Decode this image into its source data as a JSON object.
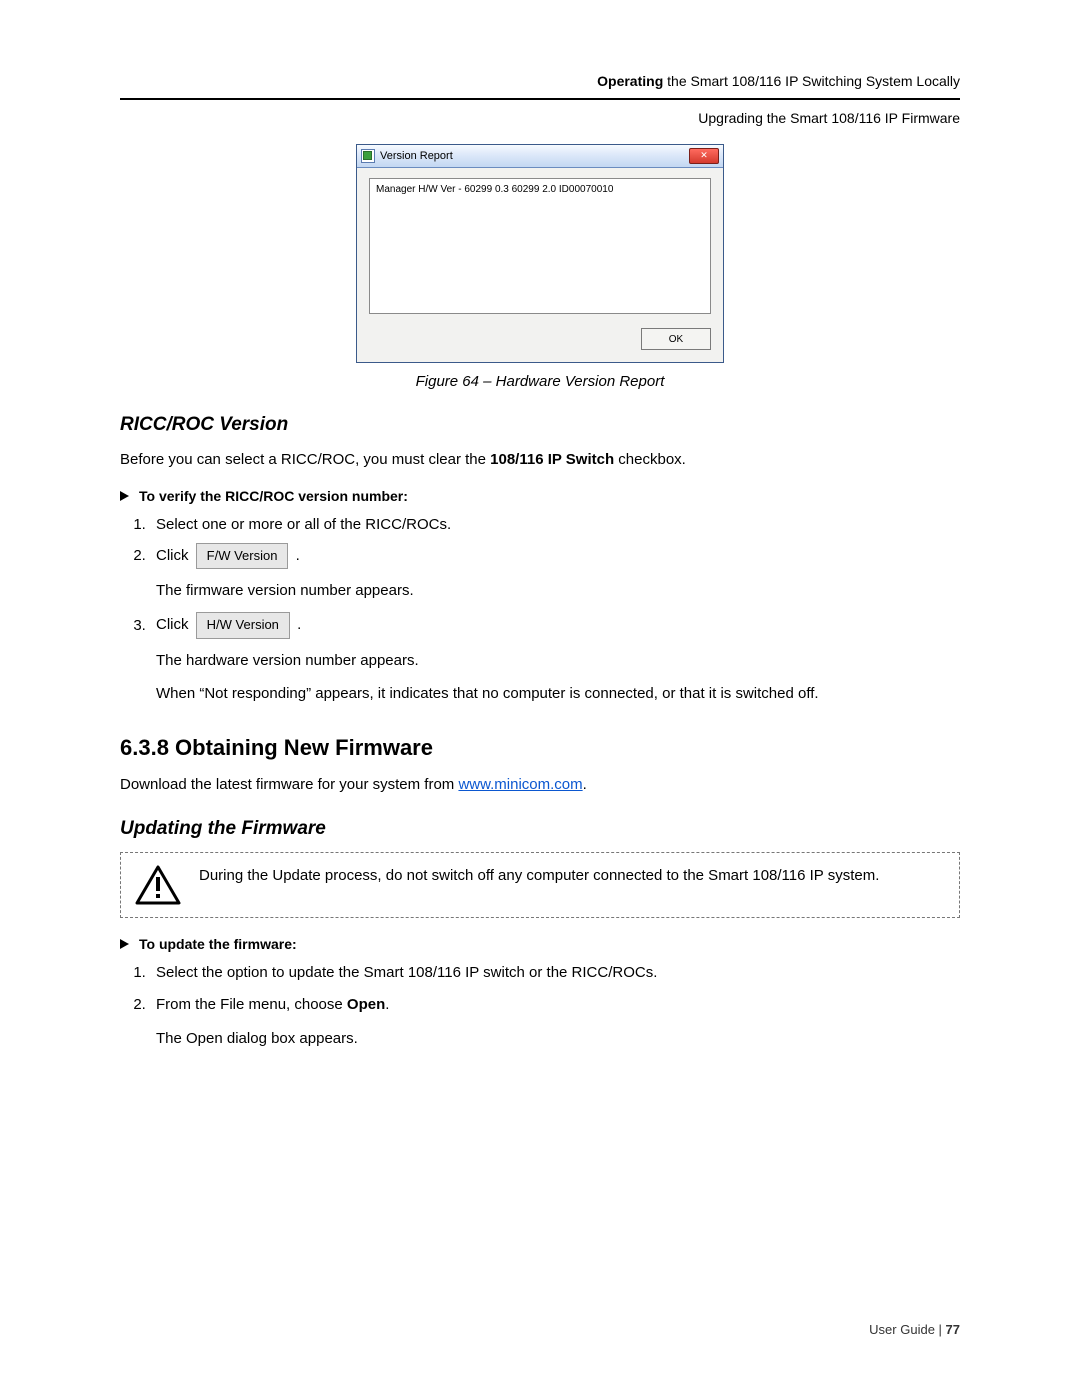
{
  "header": {
    "bold_prefix": "Operating",
    "rest": " the Smart 108/116 IP Switching System Locally",
    "subheader": "Upgrading the Smart 108/116 IP Firmware"
  },
  "dialog": {
    "title": "Version Report",
    "list_line": "Manager H/W Ver - 60299 0.3 60299 2.0 ID00070010",
    "ok": "OK"
  },
  "figure_caption": "Figure 64 – Hardware Version Report",
  "ricc": {
    "heading": "RICC/ROC Version",
    "intro_before": "Before you can select a RICC/ROC, you must clear the ",
    "intro_bold": "108/116 IP Switch",
    "intro_after": " checkbox.",
    "subtask": "To verify the RICC/ROC version number:",
    "step1": "Select one or more or all of the RICC/ROCs.",
    "step2_before": "Click ",
    "step2_button": "F/W Version",
    "step2_after": ".",
    "fw_result": "The firmware version number appears.",
    "step3_before": "Click ",
    "step3_button": "H/W Version",
    "step3_after": ".",
    "hw_result": "The hardware version number appears.",
    "not_responding": "When “Not responding” appears, it indicates that no computer is connected, or that it is switched off."
  },
  "obtain": {
    "heading": "6.3.8  Obtaining New Firmware",
    "text_before": "Download the latest firmware for your system from ",
    "link": "www.minicom.com",
    "text_after": "."
  },
  "update": {
    "heading": "Updating the Firmware",
    "warning": "During the Update process, do not switch off any computer connected to the Smart 108/116 IP system.",
    "subtask": "To update the firmware:",
    "step1": "Select the option to update the Smart 108/116 IP switch or the RICC/ROCs.",
    "step2_before": "From the File menu, choose ",
    "step2_bold": "Open",
    "step2_after": ".",
    "open_result": "The Open dialog box appears."
  },
  "footer": {
    "label": "User Guide",
    "sep": " | ",
    "page": "77"
  }
}
